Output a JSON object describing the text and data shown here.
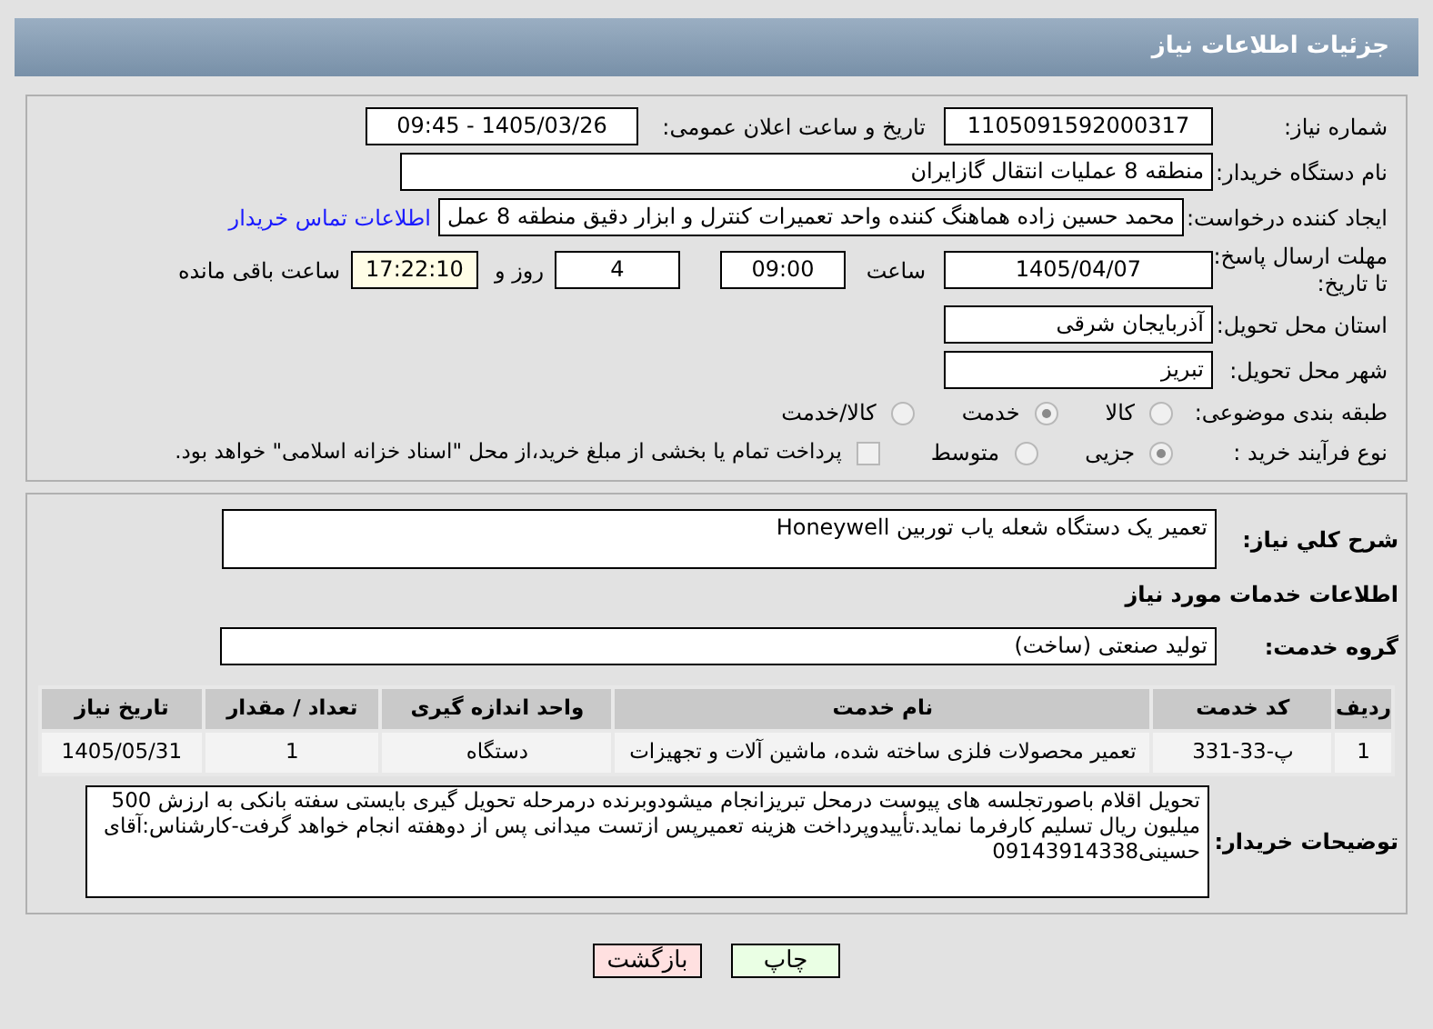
{
  "header": {
    "title": "جزئیات اطلاعات نیاز"
  },
  "details": {
    "need_number": {
      "label": "شماره نیاز:",
      "value": "1105091592000317"
    },
    "announce_date": {
      "label": "تاریخ و ساعت اعلان عمومی:",
      "value": "1405/03/26 - 09:45"
    },
    "buyer_org": {
      "label": "نام دستگاه خریدار:",
      "value": "منطقه 8 عملیات انتقال گازایران"
    },
    "requester": {
      "label": "ایجاد کننده درخواست:",
      "value": "محمد حسین زاده هماهنگ کننده واحد تعمیرات کنترل و ابزار دقیق منطقه 8 عمل",
      "link": "اطلاعات تماس خریدار"
    },
    "deadline": {
      "label": "مهلت ارسال پاسخ: تا تاریخ:",
      "date": "1405/04/07",
      "time_label": "ساعت",
      "time": "09:00",
      "days": "4",
      "days_label": "روز و",
      "remaining": "17:22:10",
      "remaining_label": "ساعت باقی مانده"
    },
    "province": {
      "label": "استان محل تحویل:",
      "value": "آذربایجان شرقی"
    },
    "city": {
      "label": "شهر محل تحویل:",
      "value": "تبریز"
    },
    "category": {
      "label": "طبقه بندی موضوعی:",
      "options": [
        {
          "label": "کالا",
          "selected": false
        },
        {
          "label": "خدمت",
          "selected": true
        },
        {
          "label": "کالا/خدمت",
          "selected": false
        }
      ]
    },
    "purchase_type": {
      "label": "نوع فرآیند خرید :",
      "options": [
        {
          "label": "جزیی",
          "selected": true
        },
        {
          "label": "متوسط",
          "selected": false
        }
      ],
      "payment": {
        "label": "پرداخت تمام یا بخشی از مبلغ خرید،از محل \"اسناد خزانه اسلامی\" خواهد بود.",
        "checked": false
      }
    }
  },
  "services": {
    "summary": {
      "label": "شرح کلي نياز:",
      "value": "تعمیر یک دستگاه شعله یاب توربین Honeywell"
    },
    "section_title": "اطلاعات خدمات مورد نیاز",
    "group": {
      "label": "گروه خدمت:",
      "value": "تولید صنعتی (ساخت)"
    },
    "table": {
      "columns": [
        "ردیف",
        "کد خدمت",
        "نام خدمت",
        "واحد اندازه گیری",
        "تعداد / مقدار",
        "تاریخ نیاز"
      ],
      "rows": [
        [
          "1",
          "پ-33-331",
          "تعمیر محصولات فلزی ساخته شده، ماشین آلات و تجهیزات",
          "دستگاه",
          "1",
          "1405/05/31"
        ]
      ]
    },
    "notes": {
      "label": "توضیحات خریدار:",
      "value": "تحویل اقلام باصورتجلسه های پیوست درمحل تبریزانجام میشودوبرنده درمرحله تحویل گیری بایستی سفته بانکی به ارزش 500 میلیون ریال تسلیم کارفرما نماید.تأییدوپرداخت هزینه تعمیرپس ازتست میدانی پس از دوهفته انجام خواهد گرفت-کارشناس:آقای حسینی09143914338"
    }
  },
  "buttons": [
    {
      "label": "چاپ",
      "kind": "print"
    },
    {
      "label": "بازگشت",
      "kind": "back"
    }
  ]
}
